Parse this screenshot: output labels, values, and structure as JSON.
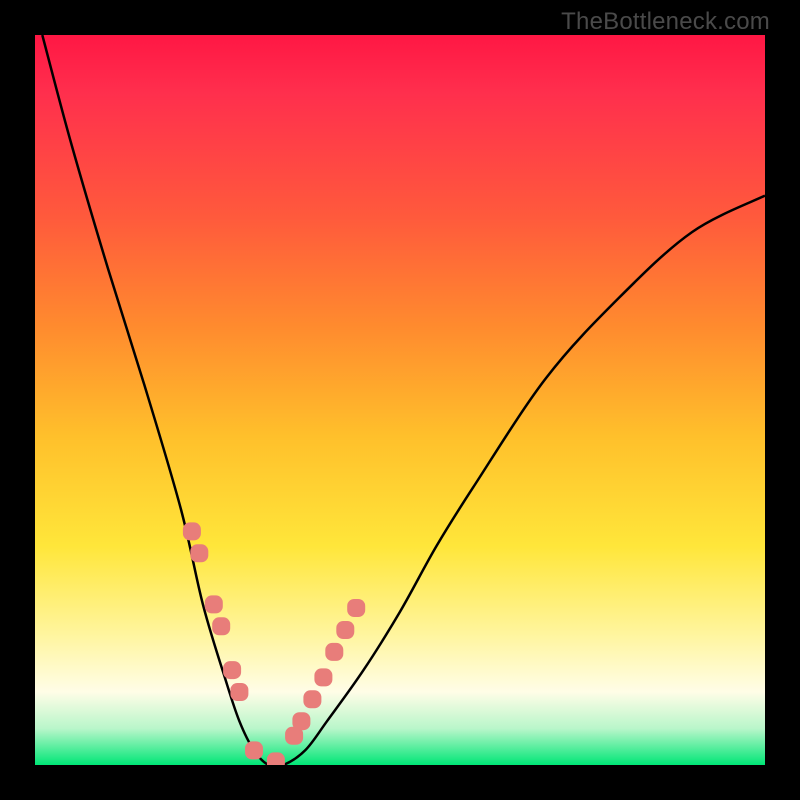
{
  "watermark": "TheBottleneck.com",
  "chart_data": {
    "type": "line",
    "title": "",
    "xlabel": "",
    "ylabel": "",
    "xlim": [
      0,
      1
    ],
    "ylim": [
      0,
      1
    ],
    "series": [
      {
        "name": "curve",
        "x": [
          0.01,
          0.05,
          0.1,
          0.15,
          0.2,
          0.23,
          0.26,
          0.28,
          0.3,
          0.32,
          0.34,
          0.37,
          0.4,
          0.45,
          0.5,
          0.55,
          0.6,
          0.7,
          0.8,
          0.9,
          1.0
        ],
        "y": [
          1.0,
          0.85,
          0.68,
          0.52,
          0.35,
          0.22,
          0.12,
          0.06,
          0.02,
          0.0,
          0.0,
          0.02,
          0.06,
          0.13,
          0.21,
          0.3,
          0.38,
          0.53,
          0.64,
          0.73,
          0.78
        ]
      }
    ],
    "markers": {
      "name": "pink-dots",
      "x": [
        0.215,
        0.225,
        0.245,
        0.255,
        0.27,
        0.28,
        0.3,
        0.33,
        0.355,
        0.365,
        0.38,
        0.395,
        0.41,
        0.425,
        0.44
      ],
      "y": [
        0.32,
        0.29,
        0.22,
        0.19,
        0.13,
        0.1,
        0.02,
        0.005,
        0.04,
        0.06,
        0.09,
        0.12,
        0.155,
        0.185,
        0.215
      ]
    },
    "gradient_stops": [
      {
        "pos": 0.0,
        "color": "#ff1744"
      },
      {
        "pos": 0.25,
        "color": "#ff5a3c"
      },
      {
        "pos": 0.55,
        "color": "#ffc02b"
      },
      {
        "pos": 0.82,
        "color": "#fff59d"
      },
      {
        "pos": 1.0,
        "color": "#00e676"
      }
    ]
  }
}
